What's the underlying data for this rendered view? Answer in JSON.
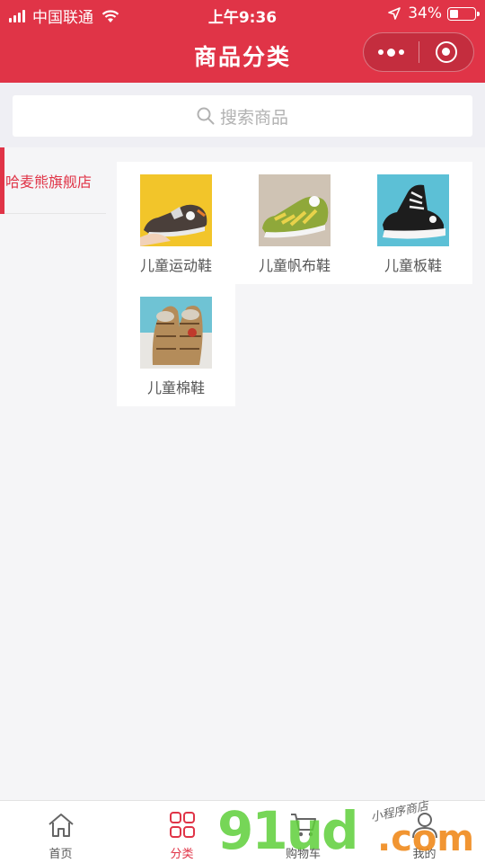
{
  "status_bar": {
    "carrier": "中国联通",
    "time": "上午9:36",
    "battery": "34%",
    "battery_level": 0.34
  },
  "nav": {
    "title": "商品分类"
  },
  "search": {
    "placeholder": "搜索商品"
  },
  "sidebar": {
    "items": [
      {
        "label": "哈麦熊旗舰店",
        "active": true
      }
    ]
  },
  "categories": [
    {
      "label": "儿童运动鞋",
      "image": "kids-sneaker-photo"
    },
    {
      "label": "儿童帆布鞋",
      "image": "kids-canvas-shoe-photo"
    },
    {
      "label": "儿童板鞋",
      "image": "kids-skate-shoe-photo"
    },
    {
      "label": "儿童棉鞋",
      "image": "kids-cotton-shoe-photo"
    }
  ],
  "tab_bar": {
    "tabs": [
      {
        "label": "首页",
        "icon": "home-icon",
        "active": false
      },
      {
        "label": "分类",
        "icon": "grid-icon",
        "active": true
      },
      {
        "label": "购物车",
        "icon": "cart-icon",
        "active": false
      },
      {
        "label": "我的",
        "icon": "user-icon",
        "active": false
      }
    ]
  },
  "watermark": {
    "brand": "91ud",
    "suffix": ".com",
    "tagline": "小程序商店"
  },
  "colors": {
    "primary": "#e03447",
    "background": "#f5f5f7",
    "text": "#555555"
  }
}
